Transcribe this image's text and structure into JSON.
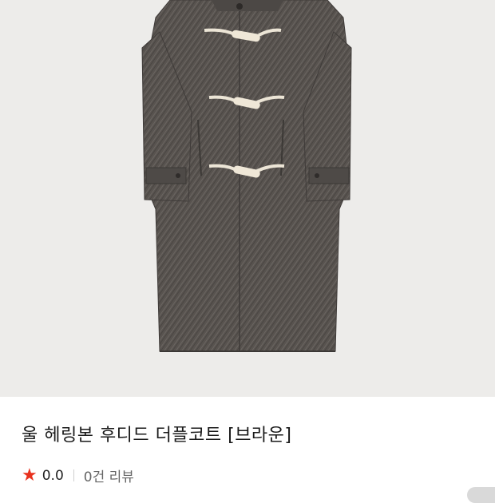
{
  "product": {
    "title": "울 헤링본 후디드 더플코트 [브라운]",
    "rating": "0.0",
    "review_count_label": "0건 리뷰",
    "rating_icon": "star-icon",
    "image_alt": "duffle coat product image"
  },
  "colors": {
    "image_bg": "#edecea",
    "coat": "#57524f",
    "star": "#e8321e"
  }
}
